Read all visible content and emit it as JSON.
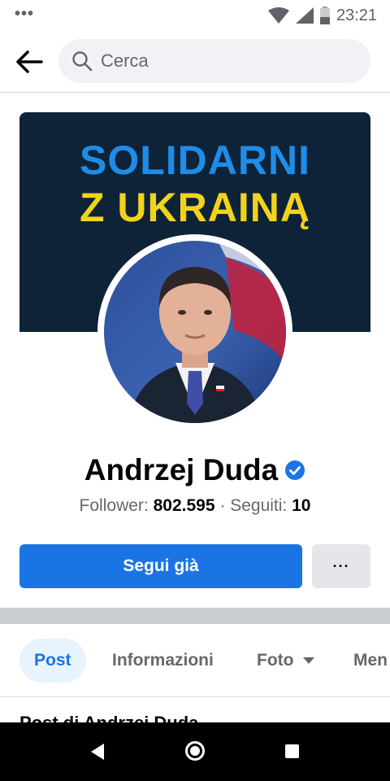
{
  "status_bar": {
    "time": "23:21",
    "icons": [
      "notification-dots-icon",
      "wifi-icon",
      "signal-icon",
      "battery-icon"
    ]
  },
  "header": {
    "search_placeholder": "Cerca",
    "icons": [
      "back-arrow-icon",
      "search-icon"
    ]
  },
  "cover": {
    "line1": "SOLIDARNI",
    "line2": "Z UKRAINĄ",
    "colors": {
      "background": "#0e2338",
      "line1": "#1f8ce8",
      "line2": "#f2d31c"
    }
  },
  "profile": {
    "name": "Andrzej Duda",
    "verified": true,
    "followers_label": "Follower:",
    "followers_count": "802.595",
    "separator": "·",
    "following_label": "Seguiti:",
    "following_count": "10"
  },
  "actions": {
    "follow_label": "Segui già",
    "more_label": "···"
  },
  "tabs": [
    {
      "label": "Post",
      "active": true
    },
    {
      "label": "Informazioni",
      "active": false
    },
    {
      "label": "Foto",
      "active": false,
      "dropdown": true
    },
    {
      "label": "Men",
      "active": false
    }
  ],
  "posts_heading": "Post di Andrzej Duda",
  "colors": {
    "accent": "#1b74e4",
    "secondary_text": "#65676b",
    "divider": "#c9ccd1"
  }
}
